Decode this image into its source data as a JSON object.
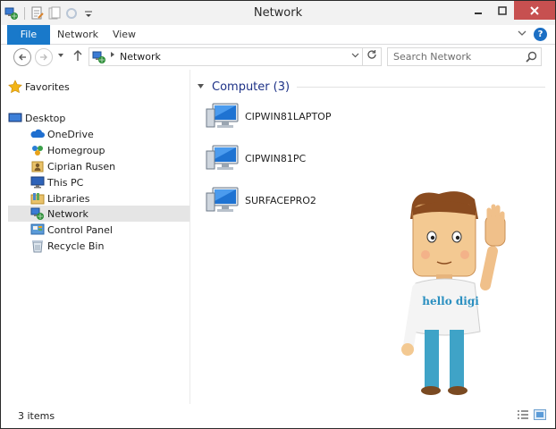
{
  "window": {
    "title": "Network"
  },
  "ribbon": {
    "tabs": [
      {
        "label": "File"
      },
      {
        "label": "Network"
      },
      {
        "label": "View"
      }
    ],
    "help": "?"
  },
  "address": {
    "icon": "network-icon",
    "breadcrumb": "Network",
    "search_placeholder": "Search Network"
  },
  "nav": {
    "favorites": "Favorites",
    "desktop": "Desktop",
    "items": [
      {
        "label": "OneDrive",
        "icon": "onedrive-icon"
      },
      {
        "label": "Homegroup",
        "icon": "homegroup-icon"
      },
      {
        "label": "Ciprian Rusen",
        "icon": "user-folder-icon"
      },
      {
        "label": "This PC",
        "icon": "this-pc-icon"
      },
      {
        "label": "Libraries",
        "icon": "libraries-icon"
      },
      {
        "label": "Network",
        "icon": "network-icon",
        "selected": true
      },
      {
        "label": "Control Panel",
        "icon": "control-panel-icon"
      },
      {
        "label": "Recycle Bin",
        "icon": "recycle-bin-icon"
      }
    ]
  },
  "content": {
    "group_title": "Computer",
    "group_count": "(3)",
    "computers": [
      {
        "name": "CIPWIN81LAPTOP"
      },
      {
        "name": "CIPWIN81PC"
      },
      {
        "name": "SURFACEPRO2"
      }
    ]
  },
  "mascot": {
    "shirt_text": "hello digi"
  },
  "status": {
    "item_count": "3 items"
  },
  "colors": {
    "accent": "#1979ca",
    "group_title": "#1e3287",
    "close": "#c75050",
    "selection": "#e5e5e5"
  }
}
